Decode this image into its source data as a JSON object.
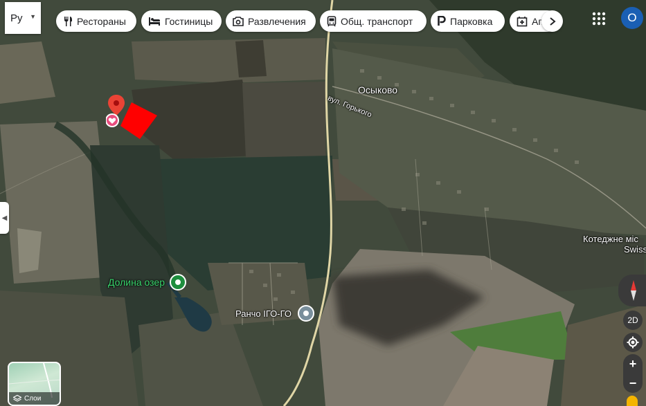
{
  "search": {
    "value": "Ру"
  },
  "chips": [
    {
      "label": "Рестораны",
      "icon": "restaurant-icon"
    },
    {
      "label": "Гостиницы",
      "icon": "hotel-icon"
    },
    {
      "label": "Развлечения",
      "icon": "camera-icon"
    },
    {
      "label": "Общ. транспорт",
      "icon": "transit-icon"
    },
    {
      "label": "Парковка",
      "icon": "parking-icon"
    },
    {
      "label": "Ап",
      "icon": "pharmacy-icon"
    }
  ],
  "account": {
    "initial": "О"
  },
  "map": {
    "labels": {
      "village": "Осыково",
      "street": "вул. Горького",
      "cottage": "Котеджне міс",
      "cottage_sub": "Swiss",
      "lakes": "Долина озер",
      "ranch": "Ранчо ІГО-ГО"
    },
    "colors": {
      "pin": "#ea4335",
      "highlight": "#ff0000",
      "park_pin": "#1e8e3e",
      "place_pin": "#7a8f9c"
    }
  },
  "controls": {
    "mode_label": "2D",
    "zoom_in": "+",
    "zoom_out": "−"
  },
  "layers": {
    "label": "Слои"
  }
}
